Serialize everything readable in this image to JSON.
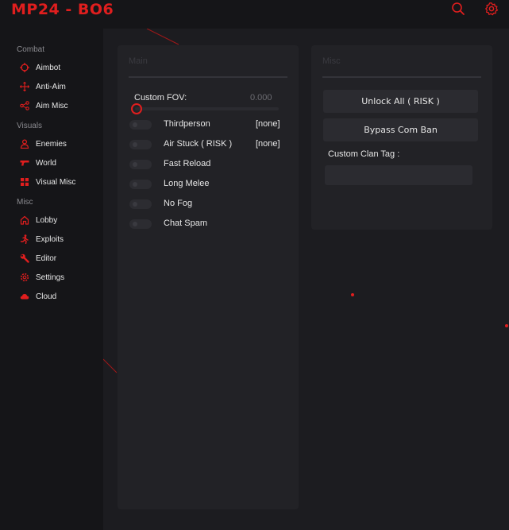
{
  "app": {
    "title": "MP24 - BO6"
  },
  "header": {
    "search_icon": "search-icon",
    "settings_icon": "gear-icon"
  },
  "colors": {
    "accent": "#e01e1e",
    "background": "#151518",
    "panel": "#222226",
    "control": "#2b2b30"
  },
  "sidebar": {
    "sections": [
      {
        "label": "Combat"
      },
      {
        "label": "Visuals"
      },
      {
        "label": "Misc"
      }
    ],
    "items": [
      {
        "label": "Aimbot",
        "icon": "crosshair-icon"
      },
      {
        "label": "Anti-Aim",
        "icon": "move-arrows-icon"
      },
      {
        "label": "Aim Misc",
        "icon": "share-icon"
      },
      {
        "label": "Enemies",
        "icon": "user-icon"
      },
      {
        "label": "World",
        "icon": "gun-icon"
      },
      {
        "label": "Visual Misc",
        "icon": "grid-icon"
      },
      {
        "label": "Lobby",
        "icon": "home-icon"
      },
      {
        "label": "Exploits",
        "icon": "running-person-icon"
      },
      {
        "label": "Editor",
        "icon": "wrench-icon"
      },
      {
        "label": "Settings",
        "icon": "gear-icon"
      },
      {
        "label": "Cloud",
        "icon": "cloud-icon"
      }
    ]
  },
  "main_panel": {
    "title": "Main",
    "fov": {
      "label": "Custom FOV:",
      "value": "0.000",
      "fraction": 0
    },
    "toggles": [
      {
        "label": "Thirdperson",
        "bind": "[none]",
        "enabled": false
      },
      {
        "label": "Air Stuck ( RISK )",
        "bind": "[none]",
        "enabled": false
      },
      {
        "label": "Fast Reload",
        "enabled": false
      },
      {
        "label": "Long Melee",
        "enabled": false
      },
      {
        "label": "No Fog",
        "enabled": false
      },
      {
        "label": "Chat Spam",
        "enabled": false
      }
    ]
  },
  "misc_panel": {
    "title": "Misc",
    "unlock_button": "Unlock All ( RISK )",
    "bypass_button": "Bypass Com Ban",
    "clan_tag_label": "Custom Clan Tag :",
    "clan_tag_value": ""
  }
}
